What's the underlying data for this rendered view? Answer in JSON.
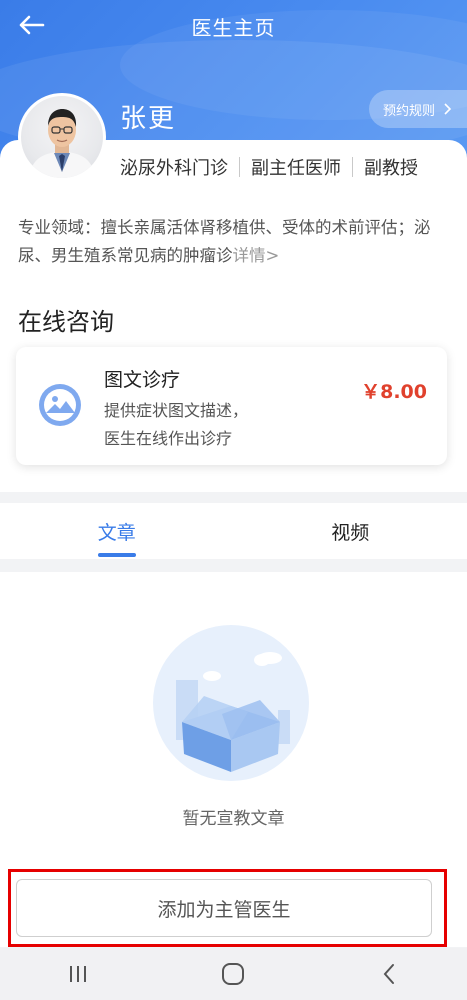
{
  "topbar": {
    "title": "医生主页",
    "back_icon": "arrow-left-icon"
  },
  "rules_button": {
    "label": "预约规则",
    "icon": "chevron-right-icon"
  },
  "doctor": {
    "name": "张更",
    "tags": [
      "泌尿外科门诊",
      "副主任医师",
      "副教授"
    ],
    "specialty_text": "专业领域：擅长亲属活体肾移植供、受体的术前评估；泌尿、男生殖系常见病的肿瘤诊",
    "specialty_more": "详情>"
  },
  "consult": {
    "section_title": "在线咨询",
    "service": {
      "icon": "image-consult-icon",
      "name": "图文诊疗",
      "desc_line1": "提供症状图文描述，",
      "desc_line2": "医生在线作出诊疗",
      "price": "￥8.00"
    }
  },
  "tabs": [
    {
      "label": "文章",
      "active": true
    },
    {
      "label": "视频",
      "active": false
    }
  ],
  "empty_state": {
    "text": "暂无宣教文章",
    "icon": "empty-box-icon"
  },
  "add_button": {
    "label": "添加为主管医生"
  },
  "system_nav": {
    "recents_icon": "recents-icon",
    "home_icon": "home-icon",
    "back_icon": "back-chevron-icon"
  },
  "colors": {
    "brand": "#3a7ce8",
    "price": "#e0412d",
    "highlight_frame": "#e60000"
  }
}
